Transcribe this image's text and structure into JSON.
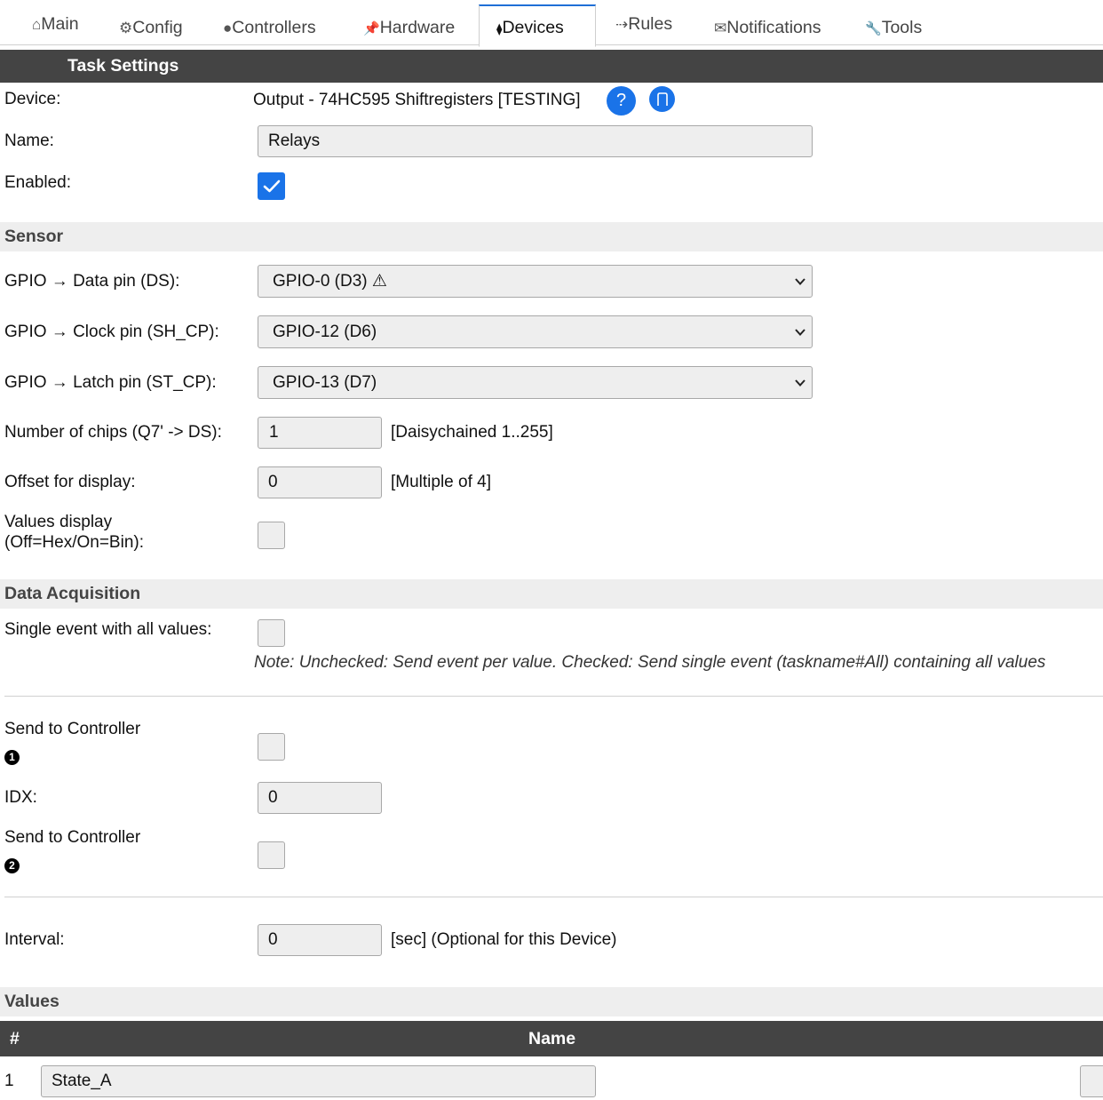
{
  "tabs": [
    {
      "icon": "⌂",
      "label": "Main"
    },
    {
      "icon": "⚙",
      "label": "Config"
    },
    {
      "icon": "●",
      "label": "Controllers"
    },
    {
      "icon": "📌",
      "label": "Hardware"
    },
    {
      "icon": "⧫",
      "label": "Devices"
    },
    {
      "icon": "⇢",
      "label": "Rules"
    },
    {
      "icon": "✉",
      "label": "Notifications"
    },
    {
      "icon": "🔧",
      "label": "Tools"
    }
  ],
  "active_tab": "Devices",
  "task": {
    "title": "Task Settings",
    "device_label": "Device:",
    "device_value": "Output - 74HC595 Shiftregisters [TESTING]",
    "help_glyph": "?",
    "name_label": "Name:",
    "name_value": "Relays",
    "enabled_label": "Enabled:",
    "enabled": true
  },
  "sensor": {
    "title": "Sensor",
    "data_pin_label": "GPIO → Data pin (DS):",
    "data_pin_value": "GPIO-0 (D3) ⚠",
    "clock_pin_label": "GPIO → Clock pin (SH_CP):",
    "clock_pin_value": "GPIO-12 (D6)",
    "latch_pin_label": "GPIO → Latch pin (ST_CP):",
    "latch_pin_value": "GPIO-13 (D7)",
    "chips_label": "Number of chips (Q7' -> DS):",
    "chips_value": "1",
    "chips_hint": "[Daisychained 1..255]",
    "offset_label": "Offset for display:",
    "offset_value": "0",
    "offset_hint": "[Multiple of 4]",
    "values_display_label_1": "Values display",
    "values_display_label_2": "(Off=Hex/On=Bin):",
    "values_display": false
  },
  "acquisition": {
    "title": "Data Acquisition",
    "single_event_label": "Single event with all values:",
    "single_event": false,
    "note": "Note: Unchecked: Send event per value. Checked: Send single event (taskname#All) containing all values",
    "controller1_label": "Send to Controller",
    "controller1_num": "1",
    "controller1": false,
    "idx_label": "IDX:",
    "idx_value": "0",
    "controller2_label": "Send to Controller",
    "controller2_num": "2",
    "controller2": false,
    "interval_label": "Interval:",
    "interval_value": "0",
    "interval_hint": "[sec] (Optional for this Device)"
  },
  "values": {
    "title": "Values",
    "col_num": "#",
    "col_name": "Name",
    "rows": [
      {
        "num": "1",
        "name": "State_A"
      }
    ]
  },
  "colors": {
    "accent": "#1a73e8",
    "header_bg": "#444444",
    "section_bg": "#eeeeee"
  }
}
